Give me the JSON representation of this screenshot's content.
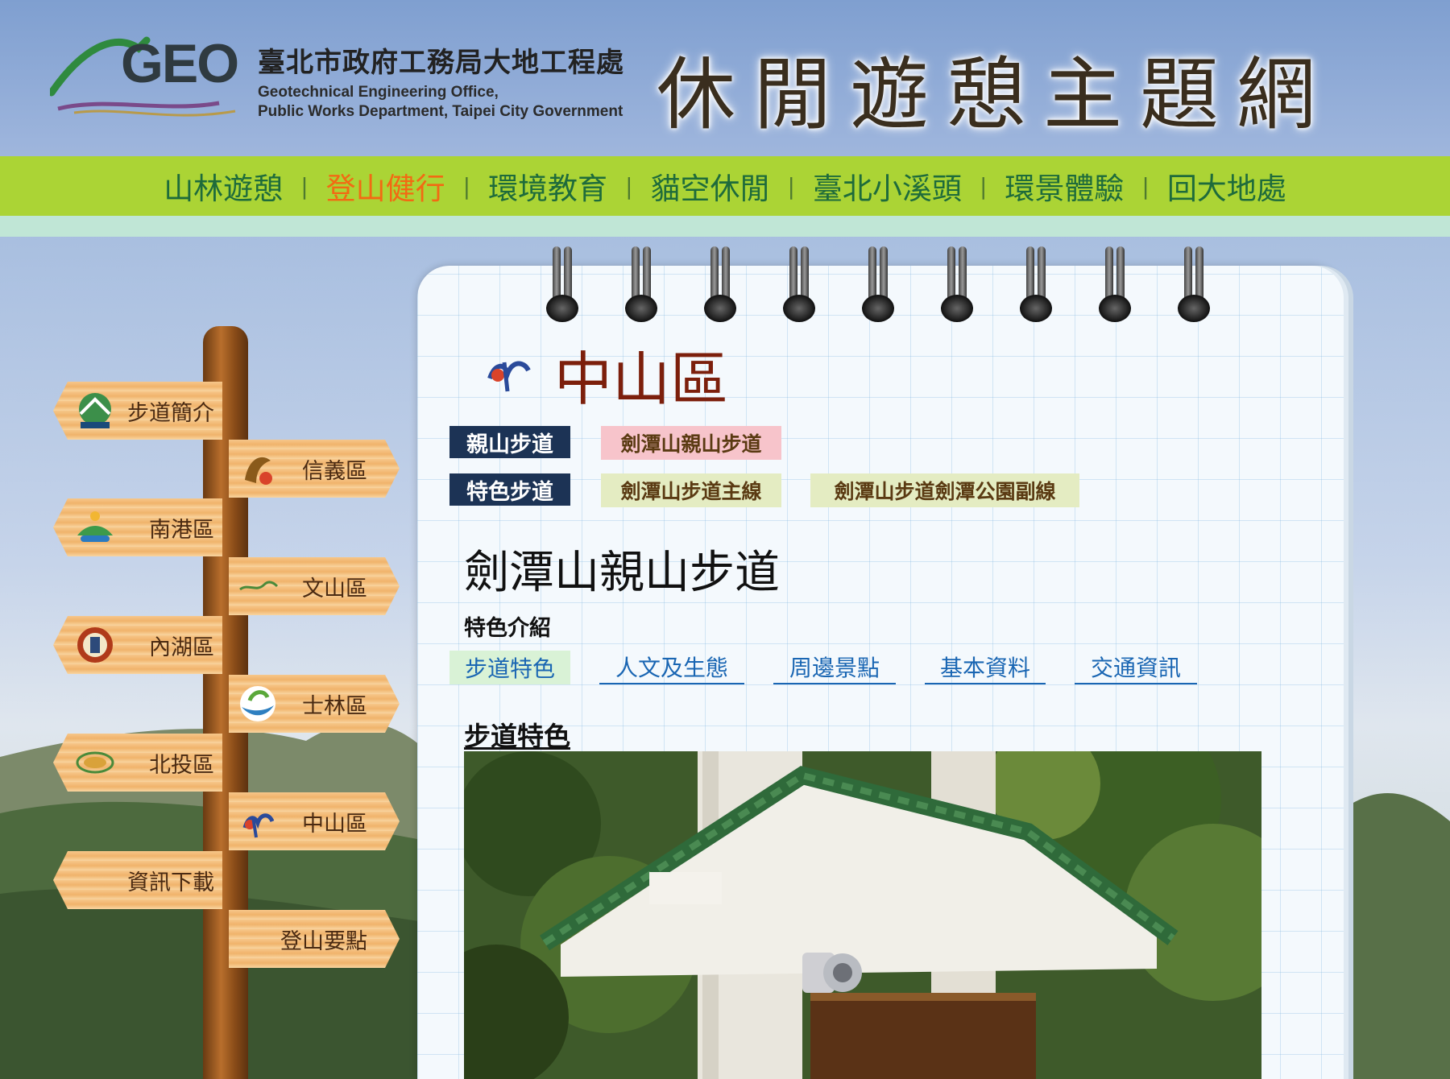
{
  "header": {
    "logo_text": "GEO",
    "org_name_zh": "臺北市政府工務局大地工程處",
    "org_name_en": "Geotechnical Engineering Office,\nPublic Works Department, Taipei City Government",
    "site_title": "休閒遊憩主題網"
  },
  "nav": {
    "items": [
      {
        "label": "山林遊憩",
        "active": false
      },
      {
        "label": "登山健行",
        "active": true
      },
      {
        "label": "環境教育",
        "active": false
      },
      {
        "label": "貓空休閒",
        "active": false
      },
      {
        "label": "臺北小溪頭",
        "active": false
      },
      {
        "label": "環景體驗",
        "active": false
      },
      {
        "label": "回大地處",
        "active": false
      }
    ],
    "separator": "|"
  },
  "signpost": {
    "signs": [
      {
        "label": "步道簡介",
        "icon": "taipei-logo-icon"
      },
      {
        "label": "信義區",
        "icon": "xinyi-logo-icon"
      },
      {
        "label": "南港區",
        "icon": "nangang-logo-icon"
      },
      {
        "label": "文山區",
        "icon": "wenshan-logo-icon"
      },
      {
        "label": "內湖區",
        "icon": "neihu-logo-icon"
      },
      {
        "label": "士林區",
        "icon": "shilin-logo-icon"
      },
      {
        "label": "北投區",
        "icon": "beitou-logo-icon"
      },
      {
        "label": "中山區",
        "icon": "zhongshan-logo-icon"
      },
      {
        "label": "資訊下載",
        "icon": ""
      },
      {
        "label": "登山要點",
        "icon": ""
      }
    ]
  },
  "content": {
    "district_title": "中山區",
    "categories": [
      {
        "label": "親山步道",
        "trails": [
          "劍潭山親山步道"
        ]
      },
      {
        "label": "特色步道",
        "trails": [
          "劍潭山步道主線",
          "劍潭山步道劍潭公園副線"
        ]
      }
    ],
    "trail_name": "劍潭山親山步道",
    "sub_heading": "特色介紹",
    "tabs": [
      {
        "label": "步道特色",
        "active": true
      },
      {
        "label": "人文及生態",
        "active": false
      },
      {
        "label": "周邊景點",
        "active": false
      },
      {
        "label": "基本資料",
        "active": false
      },
      {
        "label": "交通資訊",
        "active": false
      }
    ],
    "section_heading": "步道特色"
  },
  "colors": {
    "nav_bg": "#abd435",
    "nav_text": "#1e6b3b",
    "nav_active": "#f26a13",
    "title_red": "#7c1f0c",
    "label_navy": "#1c3355",
    "link_blue": "#1a66b3"
  }
}
